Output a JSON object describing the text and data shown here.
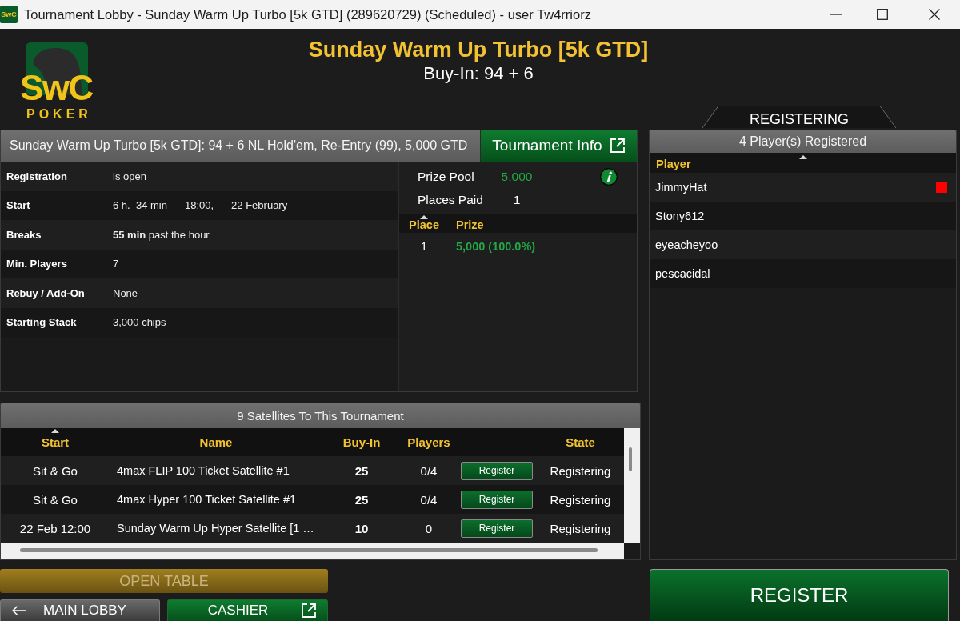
{
  "window": {
    "title": "Tournament Lobby - Sunday Warm Up Turbo [5k GTD] (289620729) (Scheduled) - user Tw4rriorz",
    "app_icon_text": "SwC"
  },
  "logo": {
    "brand": "SwC",
    "subtitle": "POKER"
  },
  "header": {
    "title": "Sunday Warm Up Turbo [5k GTD]",
    "buy_in": "Buy-In: 94 + 6"
  },
  "info_panel": {
    "summary": "Sunday Warm Up Turbo [5k GTD]: 94 + 6 NL Hold'em, Re-Entry (99), 5,000 GTD",
    "info_button": "Tournament Info",
    "details": [
      {
        "label": "Registration",
        "values": [
          "is open"
        ]
      },
      {
        "label": "Start",
        "values": [
          "6 h.  34 min",
          "18:00,",
          "22 February"
        ]
      },
      {
        "label": "Breaks",
        "values": [
          "**55 min** past the hour"
        ]
      },
      {
        "label": "Min. Players",
        "values": [
          "7"
        ]
      },
      {
        "label": "Rebuy / Add-On",
        "values": [
          "None"
        ]
      },
      {
        "label": "Starting Stack",
        "values": [
          "3,000 chips"
        ]
      }
    ],
    "prize": {
      "prize_pool_label": "Prize Pool",
      "prize_pool": "5,000",
      "places_paid_label": "Places Paid",
      "places_paid": "1",
      "columns": [
        {
          "label": "Place",
          "sorted": true
        },
        {
          "label": "Prize",
          "sorted": false
        }
      ],
      "rows": [
        {
          "place": "1",
          "prize": "5,000 (100.0%)"
        }
      ]
    }
  },
  "satellites": {
    "title": "9 Satellites To This Tournament",
    "columns": [
      {
        "label": "Start",
        "sorted": true
      },
      {
        "label": "Name",
        "sorted": false
      },
      {
        "label": "Buy-In",
        "sorted": false
      },
      {
        "label": "Players",
        "sorted": false
      },
      {
        "label": "State",
        "sorted": false
      }
    ],
    "rows": [
      {
        "start": "Sit & Go",
        "name": "4max FLIP 100 Ticket Satellite #1",
        "buy_in": "25",
        "players": "0/4",
        "action": "Register",
        "state": "Registering"
      },
      {
        "start": "Sit & Go",
        "name": "4max Hyper 100 Ticket Satellite #1",
        "buy_in": "25",
        "players": "0/4",
        "action": "Register",
        "state": "Registering"
      },
      {
        "start": "22 Feb 12:00",
        "name": "Sunday Warm Up Hyper Satellite [1 …",
        "buy_in": "10",
        "players": "0",
        "action": "Register",
        "state": "Registering"
      }
    ]
  },
  "status_tab": "REGISTERING",
  "players": {
    "title": "4 Player(s) Registered",
    "column": {
      "label": "Player",
      "sorted": true
    },
    "rows": [
      {
        "name": "JimmyHat",
        "color": "#ff0000"
      },
      {
        "name": "Stony612"
      },
      {
        "name": "eyeacheyoo"
      },
      {
        "name": "pescacidal"
      }
    ]
  },
  "buttons": {
    "open_table": {
      "label": "OPEN TABLE",
      "disabled": true
    },
    "main_lobby": "MAIN LOBBY",
    "cashier": "CASHIER",
    "register": "REGISTER"
  }
}
